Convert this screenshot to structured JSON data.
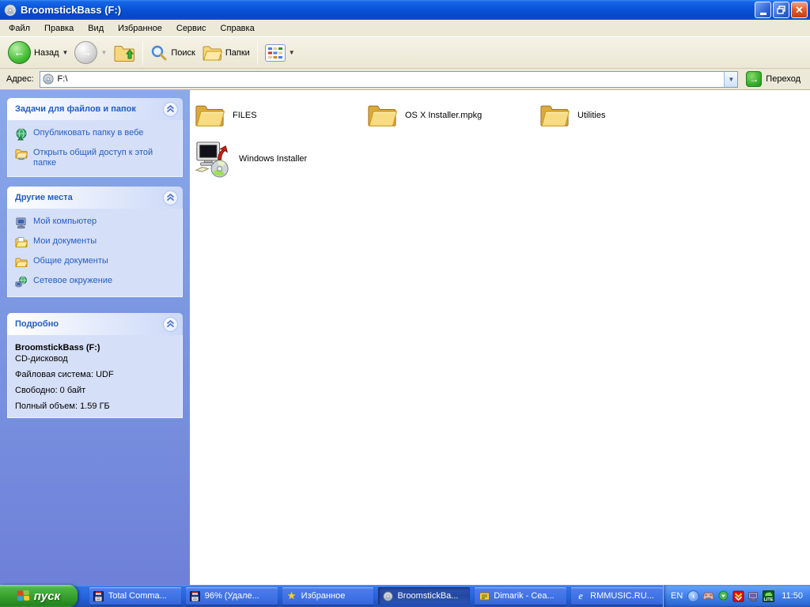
{
  "window": {
    "title": "BroomstickBass (F:)"
  },
  "menu": {
    "items": [
      {
        "label": "Файл"
      },
      {
        "label": "Правка"
      },
      {
        "label": "Вид"
      },
      {
        "label": "Избранное"
      },
      {
        "label": "Сервис"
      },
      {
        "label": "Справка"
      }
    ]
  },
  "toolbar": {
    "back_label": "Назад",
    "search_label": "Поиск",
    "folders_label": "Папки"
  },
  "address": {
    "label": "Адрес:",
    "value": "F:\\",
    "go_label": "Переход"
  },
  "sidebar": {
    "tasks": {
      "title": "Задачи для файлов и папок",
      "items": [
        {
          "label": "Опубликовать папку в вебе",
          "icon": "publish-web-icon"
        },
        {
          "label": "Открыть общий доступ к этой папке",
          "icon": "shared-folder-icon"
        }
      ]
    },
    "places": {
      "title": "Другие места",
      "items": [
        {
          "label": "Мой компьютер",
          "icon": "my-computer-icon"
        },
        {
          "label": "Мои документы",
          "icon": "my-documents-icon"
        },
        {
          "label": "Общие документы",
          "icon": "shared-documents-icon"
        },
        {
          "label": "Сетевое окружение",
          "icon": "network-icon"
        }
      ]
    },
    "details": {
      "title": "Подробно",
      "name": "BroomstickBass (F:)",
      "type": "CD-дисковод",
      "filesystem": "Файловая система: UDF",
      "free": "Свободно: 0 байт",
      "capacity": "Полный объем: 1.59 ГБ"
    }
  },
  "files": {
    "items": [
      {
        "label": "FILES",
        "icon": "folder-icon"
      },
      {
        "label": "OS X Installer.mpkg",
        "icon": "folder-icon"
      },
      {
        "label": "Utilities",
        "icon": "folder-icon"
      },
      {
        "label": "Windows Installer",
        "icon": "installer-icon"
      }
    ]
  },
  "taskbar": {
    "start_label": "пуск",
    "buttons": [
      {
        "label": "Total Comma...",
        "icon": "floppy-icon"
      },
      {
        "label": "96%  (Удале...",
        "icon": "floppy-icon"
      },
      {
        "label": "Избранное",
        "icon": "star-icon"
      },
      {
        "label": "BroomstickBa...",
        "icon": "cd-icon"
      },
      {
        "label": "Dimarik - Cea...",
        "icon": "playlist-icon"
      },
      {
        "label": "RMMUSIC.RU...",
        "icon": "ie-icon"
      }
    ],
    "tray": {
      "language": "EN",
      "clock": "11:50",
      "icons": [
        "gamepad-tray-icon",
        "green-arrow-tray-icon",
        "red-badge-tray-icon",
        "display-tray-icon",
        "lite-tray-icon"
      ]
    }
  },
  "colors": {
    "accent_link": "#215dc6",
    "titlebar_blue": "#0a55dd",
    "taskbar_blue": "#2663dc",
    "start_green": "#36a02c",
    "folder_yellow": "#f2c457"
  }
}
